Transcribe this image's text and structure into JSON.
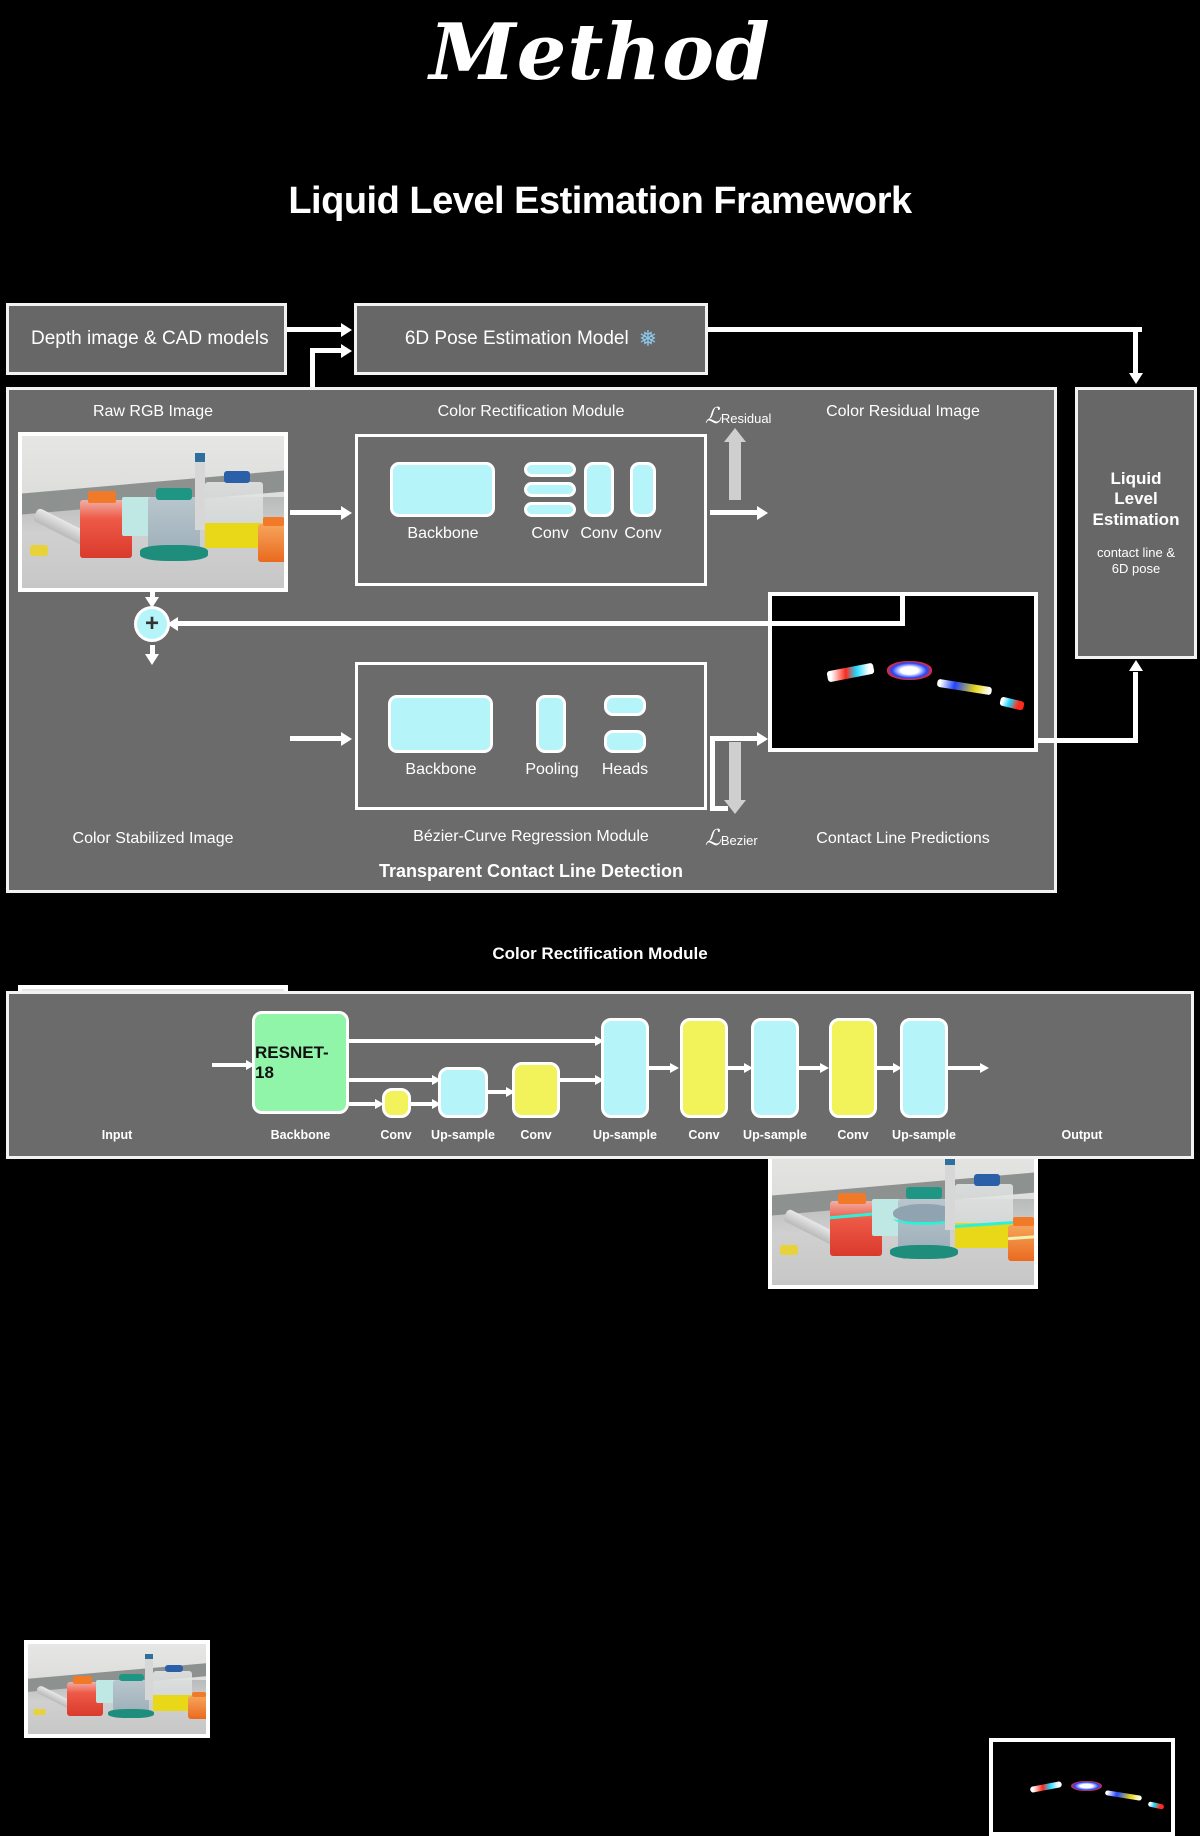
{
  "titles": {
    "method": "Method",
    "framework": "Liquid Level Estimation Framework",
    "bottom_section": "Color Rectification Module"
  },
  "top_row": {
    "depth_box": "Depth image & CAD models",
    "pose_box": "6D Pose Estimation Model",
    "pose_icon": "snowflake-icon",
    "pose_icon_glyph": "❅"
  },
  "framework": {
    "raw_rgb_caption": "Raw RGB Image",
    "color_rectification_title": "Color Rectification Module",
    "color_residual_caption": "Color Residual Image",
    "loss_residual": {
      "symbol": "ℒ",
      "subscript": "Residual"
    },
    "loss_bezier": {
      "symbol": "ℒ",
      "subscript": "Bezier"
    },
    "color_stabilized_caption": "Color Stabilized Image",
    "bezier_module_title": "Bézier-Curve Regression Module",
    "transparent_title": "Transparent Contact Line Detection",
    "contact_line_caption": "Contact Line Predictions",
    "plus_symbol": "+",
    "rect_blocks": [
      {
        "label": "Backbone"
      },
      {
        "label": "Conv"
      },
      {
        "label": "Conv"
      },
      {
        "label": "Conv"
      }
    ],
    "bezier_blocks": [
      {
        "label": "Backbone"
      },
      {
        "label": "Pooling"
      },
      {
        "label": "Heads"
      }
    ]
  },
  "liquid_level_box": {
    "title_line1": "Liquid",
    "title_line2": "Level",
    "title_line3": "Estimation",
    "sub_line1": "contact line &",
    "sub_line2": "6D pose"
  },
  "bottom_pipeline": {
    "backbone_text": "RESNET-18",
    "stages": [
      {
        "label": "Input",
        "kind": "image"
      },
      {
        "label": "Backbone",
        "kind": "green"
      },
      {
        "label": "Conv",
        "kind": "yellow"
      },
      {
        "label": "Up-sample",
        "kind": "cyan"
      },
      {
        "label": "Conv",
        "kind": "yellow"
      },
      {
        "label": "Up-sample",
        "kind": "cyan"
      },
      {
        "label": "Conv",
        "kind": "yellow"
      },
      {
        "label": "Up-sample",
        "kind": "cyan"
      },
      {
        "label": "Conv",
        "kind": "yellow"
      },
      {
        "label": "Up-sample",
        "kind": "cyan"
      },
      {
        "label": "Output",
        "kind": "image"
      }
    ]
  },
  "colors": {
    "background": "#000000",
    "panel_gray": "#6b6b6b",
    "box_gray": "#676767",
    "border_white": "#ffffff",
    "cyan_block": "#b5f5fa",
    "yellow_block": "#f2f25a",
    "green_block": "#90f5a8",
    "snowflake_blue": "#8ec8ea",
    "loss_arrow_gray": "#cfcfcf"
  }
}
